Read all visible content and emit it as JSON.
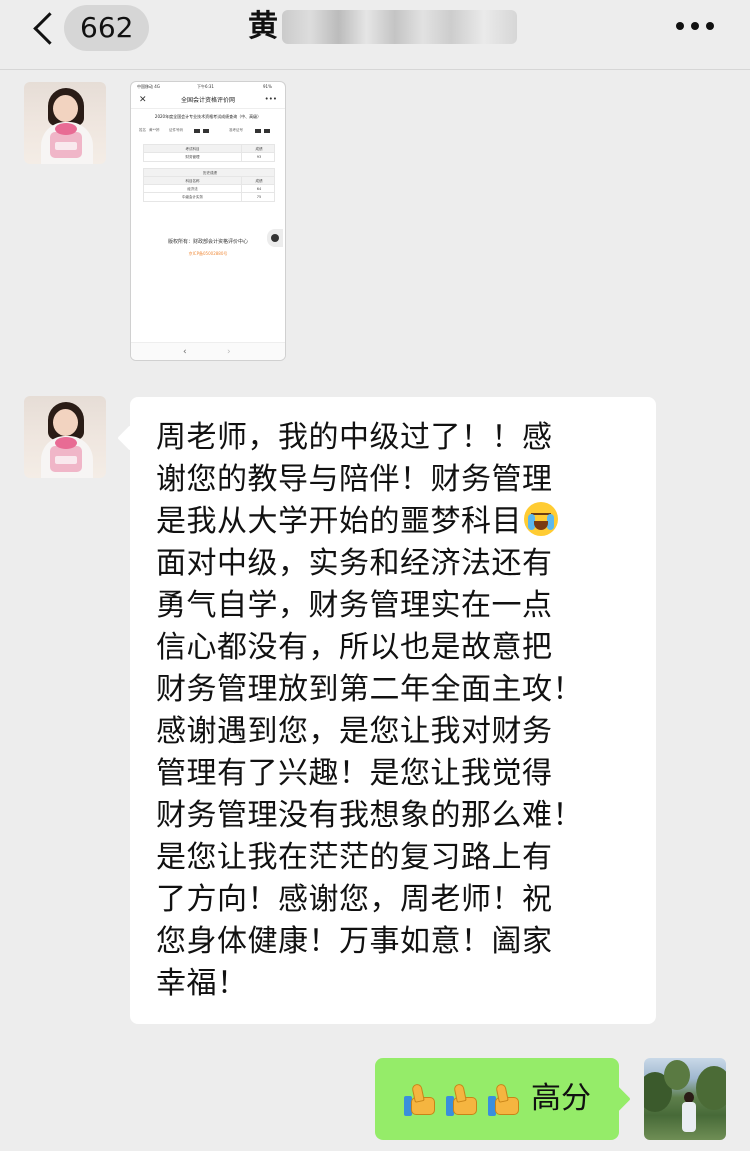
{
  "header": {
    "unread_count": "662",
    "title_visible": "黄"
  },
  "shared_screenshot": {
    "status_carrier": "中国移动 4G",
    "status_time": "下午6:31",
    "status_battery": "91%",
    "nav_close": "✕",
    "nav_title": "全国会计资格评价网",
    "nav_more": "•••",
    "subtitle": "2020年度全国会计专业技术资格考试成绩查询（中、高级）",
    "info_name_label": "姓名",
    "info_name_value": "黄**婷",
    "info_exam_label": "证件号码",
    "info_cert_label": "准考证号",
    "table1": [
      {
        "c1": "考试科目",
        "c2": "成绩",
        "head": true
      },
      {
        "c1": "财务管理",
        "c2": "93",
        "head": false
      }
    ],
    "table2_head": "历史成绩",
    "table2": [
      {
        "c1": "科目名称",
        "c2": "成绩",
        "head": true
      },
      {
        "c1": "经济法",
        "c2": "64",
        "head": false
      },
      {
        "c1": "中级会计实务",
        "c2": "75",
        "head": false
      }
    ],
    "copyright": "版权所有：财政部会计资格评价中心",
    "icp": "京ICP备05002880号",
    "nav_back": "‹",
    "nav_forward": "›"
  },
  "incoming_message": {
    "lines": [
      "周老师，我的中级过了！！感",
      "谢您的教导与陪伴！财务管理",
      "是我从大学开始的噩梦科目",
      "面对中级，实务和经济法还有",
      "勇气自学，财务管理实在一点",
      "信心都没有，所以也是故意把",
      "财务管理放到第二年全面主攻！",
      "感谢遇到您，是您让我对财务",
      "管理有了兴趣！是您让我觉得",
      "财务管理没有我想象的那么难！",
      "是您让我在茫茫的复习路上有",
      "了方向！感谢您，周老师！祝",
      "您身体健康！万事如意！阖家",
      "幸福！"
    ],
    "emoji": "loudly-crying-face"
  },
  "outgoing_message": {
    "text": "高分",
    "emoji": "thumbs-up",
    "emoji_count": 3
  },
  "colors": {
    "background": "#ededed",
    "incoming_bubble": "#ffffff",
    "outgoing_bubble": "#95ec69",
    "icp_link": "#f08c3c"
  }
}
